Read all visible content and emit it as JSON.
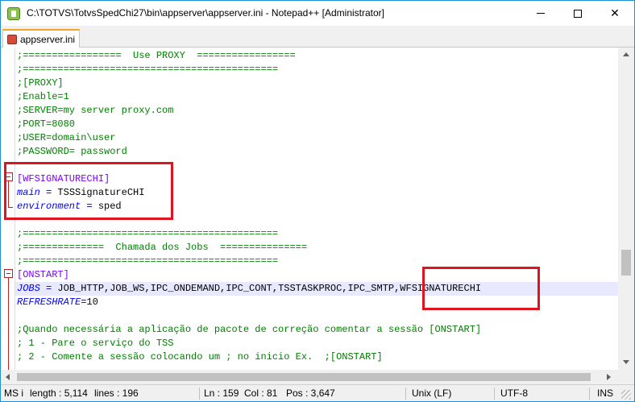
{
  "window": {
    "title": "C:\\TOTVS\\TotvsSpedChi27\\bin\\appserver\\appserver.ini - Notepad++ [Administrator]"
  },
  "controls": {
    "minimize": "minimize-icon",
    "maximize": "maximize-icon",
    "close": "close-icon",
    "close_glyph": "✕"
  },
  "tabs": [
    {
      "label": "appserver.ini",
      "active": true
    }
  ],
  "editor": {
    "lines": [
      [
        {
          "c": "c-comment",
          "t": ";=================  Use PROXY  ================="
        }
      ],
      [
        {
          "c": "c-comment",
          "t": ";============================================"
        }
      ],
      [
        {
          "c": "c-comment",
          "t": ";[PROXY]"
        }
      ],
      [
        {
          "c": "c-comment",
          "t": ";Enable=1"
        }
      ],
      [
        {
          "c": "c-comment",
          "t": ";SERVER=my server proxy.com"
        }
      ],
      [
        {
          "c": "c-comment",
          "t": ";PORT=8080"
        }
      ],
      [
        {
          "c": "c-comment",
          "t": ";USER=domain\\user"
        }
      ],
      [
        {
          "c": "c-comment",
          "t": ";PASSWORD= password"
        }
      ],
      [],
      [
        {
          "c": "c-section",
          "t": "[WFSIGNATURECHI]"
        }
      ],
      [
        {
          "c": "c-key",
          "t": "main"
        },
        {
          "c": "c-op",
          "t": " = "
        },
        {
          "c": "c-val",
          "t": "TSSSignatureCHI"
        }
      ],
      [
        {
          "c": "c-key",
          "t": "environment"
        },
        {
          "c": "c-op",
          "t": " = "
        },
        {
          "c": "c-val",
          "t": "sped"
        }
      ],
      [],
      [
        {
          "c": "c-comment",
          "t": ";============================================"
        }
      ],
      [
        {
          "c": "c-comment",
          "t": ";==============  Chamada dos Jobs  ==============="
        }
      ],
      [
        {
          "c": "c-comment",
          "t": ";============================================"
        }
      ],
      [
        {
          "c": "c-section",
          "t": "[ONSTART]"
        }
      ],
      [
        {
          "c": "c-key",
          "t": "JOBS"
        },
        {
          "c": "c-op",
          "t": " = "
        },
        {
          "c": "c-val",
          "t": "JOB_HTTP,JOB_WS,IPC_ONDEMAND,IPC_CONT,TSSTASKPROC,IPC_SMTP,WFSIGNATURECHI"
        }
      ],
      [
        {
          "c": "c-key",
          "t": "REFRESHRATE"
        },
        {
          "c": "c-op",
          "t": "="
        },
        {
          "c": "c-val",
          "t": "10"
        }
      ],
      [],
      [
        {
          "c": "c-comment",
          "t": ";Quando necessária a aplicação de pacote de correção comentar a sessão [ONSTART]"
        }
      ],
      [
        {
          "c": "c-comment",
          "t": "; 1 - Pare o serviço do TSS"
        }
      ],
      [
        {
          "c": "c-comment",
          "t": "; 2 - Comente a sessão colocando um ; no inicio Ex.  ;[ONSTART]"
        }
      ]
    ]
  },
  "statusbar": {
    "file_type": "MS i",
    "length": "length : 5,114",
    "lines": "lines : 196",
    "ln": "Ln : 159",
    "col": "Col : 81",
    "pos": "Pos : 3,647",
    "eol": "Unix (LF)",
    "encoding": "UTF-8",
    "mode": "INS"
  }
}
